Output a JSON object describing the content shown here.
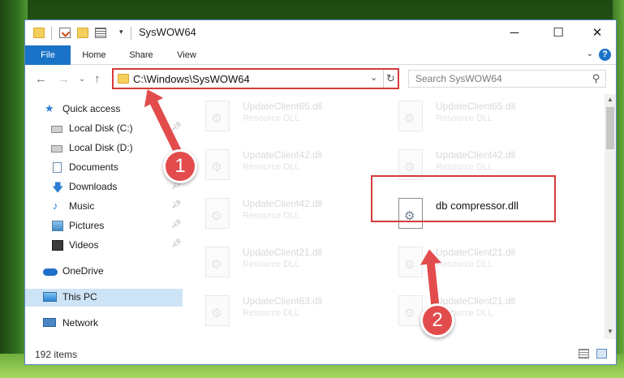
{
  "window": {
    "title": "SysWOW64",
    "buttons": {
      "minimize": "─",
      "maximize": "☐",
      "close": "✕"
    }
  },
  "ribbon": {
    "tabs": [
      {
        "label": "File",
        "active": true
      },
      {
        "label": "Home"
      },
      {
        "label": "Share"
      },
      {
        "label": "View"
      }
    ],
    "help": "?"
  },
  "address": {
    "path": "C:\\Windows\\SysWOW64",
    "search_placeholder": "Search SysWOW64"
  },
  "nav": {
    "items": [
      {
        "label": "Quick access",
        "icon": "star-icon"
      },
      {
        "label": "Local Disk (C:)",
        "icon": "drive-icon",
        "pinned": true
      },
      {
        "label": "Local Disk (D:)",
        "icon": "drive-icon"
      },
      {
        "label": "Documents",
        "icon": "documents-icon"
      },
      {
        "label": "Downloads",
        "icon": "download-icon",
        "pinned": true
      },
      {
        "label": "Music",
        "icon": "music-icon",
        "pinned": true
      },
      {
        "label": "Pictures",
        "icon": "pictures-icon",
        "pinned": true
      },
      {
        "label": "Videos",
        "icon": "videos-icon",
        "pinned": true
      },
      {
        "label": "OneDrive",
        "icon": "cloud-icon"
      },
      {
        "label": "This PC",
        "icon": "computer-icon",
        "selected": true
      },
      {
        "label": "Network",
        "icon": "network-icon"
      }
    ]
  },
  "files": {
    "left_column": [
      {
        "name": "UpdateClient65.dll",
        "type": "Resource DLL"
      },
      {
        "name": "UpdateClient42.dll",
        "type": "Resource DLL"
      },
      {
        "name": "UpdateClient42.dll",
        "type": "Resource DLL"
      },
      {
        "name": "UpdateClient21.dll",
        "type": "Resource DLL"
      },
      {
        "name": "UpdateClient63.dll",
        "type": "Resource DLL"
      }
    ],
    "right_column": [
      {
        "name": "UpdateClient65.dll",
        "type": "Resource DLL"
      },
      {
        "name": "UpdateClient42.dll",
        "type": "Resource DLL"
      },
      {
        "name": "db compressor.dll",
        "type": "",
        "highlighted": true
      },
      {
        "name": "UpdateClient21.dll",
        "type": "Resource DLL"
      },
      {
        "name": "UpdateClient21.dll",
        "type": "Resource DLL"
      }
    ]
  },
  "status": {
    "item_count": "192 items"
  },
  "annotations": {
    "step1": "1",
    "step2": "2",
    "color": "#e24c4c"
  }
}
